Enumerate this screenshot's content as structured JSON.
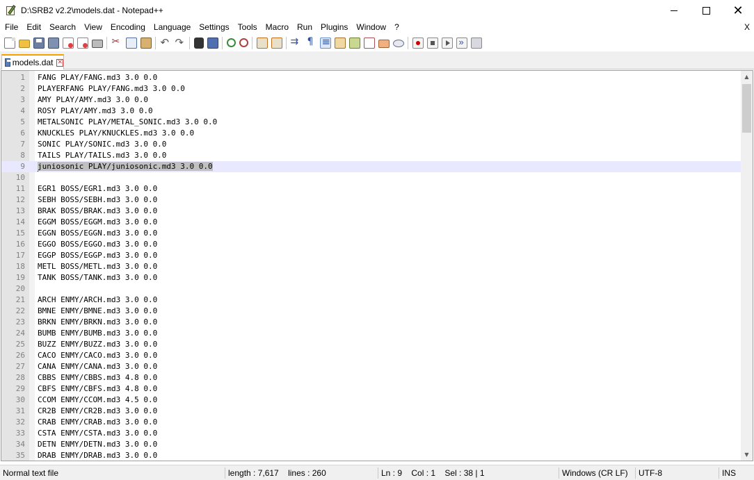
{
  "window": {
    "title": "D:\\SRB2 v2.2\\models.dat - Notepad++",
    "app_icon": "notepad-pencil-icon",
    "controls": {
      "minimize": "",
      "maximize": "",
      "close": "✕"
    }
  },
  "menu": {
    "items": [
      "File",
      "Edit",
      "Search",
      "View",
      "Encoding",
      "Language",
      "Settings",
      "Tools",
      "Macro",
      "Run",
      "Plugins",
      "Window",
      "?"
    ],
    "close_doc": "X"
  },
  "toolbar": {
    "icons": [
      "new-file-icon",
      "open-file-icon",
      "save-icon",
      "save-all-icon",
      "close-icon",
      "close-all-icon",
      "print-icon",
      "cut-icon",
      "copy-icon",
      "paste-icon",
      "undo-icon",
      "redo-icon",
      "find-icon",
      "replace-icon",
      "zoom-in-icon",
      "zoom-out-icon",
      "sync-vertical-icon",
      "sync-horizontal-icon",
      "word-wrap-icon",
      "show-all-chars-icon",
      "indent-guide-icon",
      "user-defined-language-icon",
      "document-map-icon",
      "function-list-icon",
      "folder-workspace-icon",
      "monitoring-icon",
      "start-recording-icon",
      "stop-recording-icon",
      "playback-icon",
      "run-macro-multiple-icon",
      "save-macro-icon"
    ]
  },
  "tab": {
    "label": "models.dat",
    "icon": "saved-file-icon",
    "close": "✕"
  },
  "editor": {
    "current_line": 9,
    "lines": [
      "FANG PLAY/FANG.md3 3.0 0.0",
      "PLAYERFANG PLAY/FANG.md3 3.0 0.0",
      "AMY PLAY/AMY.md3 3.0 0.0",
      "ROSY PLAY/AMY.md3 3.0 0.0",
      "METALSONIC PLAY/METAL_SONIC.md3 3.0 0.0",
      "KNUCKLES PLAY/KNUCKLES.md3 3.0 0.0",
      "SONIC PLAY/SONIC.md3 3.0 0.0",
      "TAILS PLAY/TAILS.md3 3.0 0.0",
      "juniosonic PLAY/juniosonic.md3 3.0 0.0",
      "",
      "EGR1 BOSS/EGR1.md3 3.0 0.0",
      "SEBH BOSS/SEBH.md3 3.0 0.0",
      "BRAK BOSS/BRAK.md3 3.0 0.0",
      "EGGM BOSS/EGGM.md3 3.0 0.0",
      "EGGN BOSS/EGGN.md3 3.0 0.0",
      "EGGO BOSS/EGGO.md3 3.0 0.0",
      "EGGP BOSS/EGGP.md3 3.0 0.0",
      "METL BOSS/METL.md3 3.0 0.0",
      "TANK BOSS/TANK.md3 3.0 0.0",
      "",
      "ARCH ENMY/ARCH.md3 3.0 0.0",
      "BMNE ENMY/BMNE.md3 3.0 0.0",
      "BRKN ENMY/BRKN.md3 3.0 0.0",
      "BUMB ENMY/BUMB.md3 3.0 0.0",
      "BUZZ ENMY/BUZZ.md3 3.0 0.0",
      "CACO ENMY/CACO.md3 3.0 0.0",
      "CANA ENMY/CANA.md3 3.0 0.0",
      "CBBS ENMY/CBBS.md3 4.8 0.0",
      "CBFS ENMY/CBFS.md3 4.8 0.0",
      "CCOM ENMY/CCOM.md3 4.5 0.0",
      "CR2B ENMY/CR2B.md3 3.0 0.0",
      "CRAB ENMY/CRAB.md3 3.0 0.0",
      "CSTA ENMY/CSTA.md3 3.0 0.0",
      "DETN ENMY/DETN.md3 3.0 0.0",
      "DRAB ENMY/DRAB.md3 3.0 0.0"
    ]
  },
  "scrollbar": {
    "up": "▲",
    "down": "▼"
  },
  "status": {
    "file_type": "Normal text file",
    "length_lines": "length : 7,617    lines : 260",
    "position": "Ln : 9    Col : 1    Sel : 38 | 1",
    "eol": "Windows (CR LF)",
    "encoding": "UTF-8",
    "mode": "INS"
  }
}
